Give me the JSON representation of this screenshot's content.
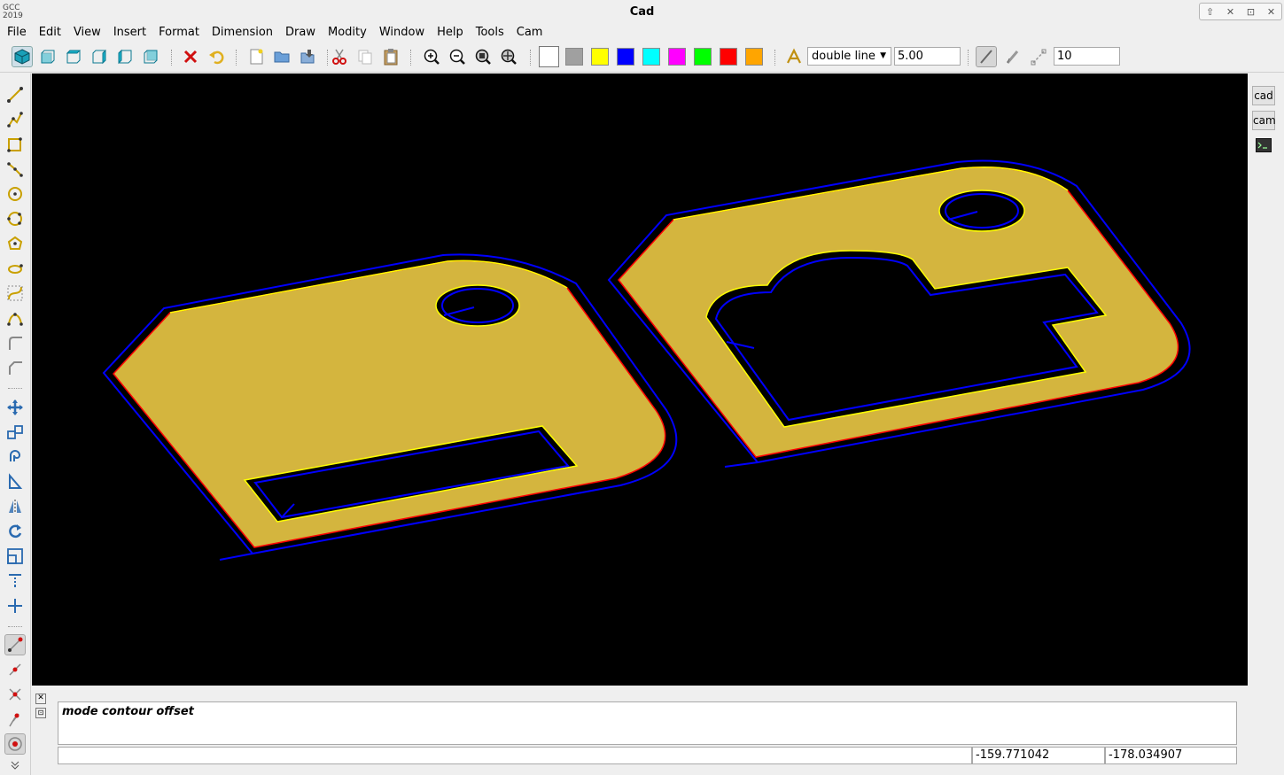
{
  "app": {
    "logo_line1": "GCC",
    "logo_line2": "2019",
    "title": "Cad"
  },
  "window_controls": [
    "up-arrow-icon",
    "close-icon",
    "maximize-icon",
    "close-icon"
  ],
  "menu": [
    "File",
    "Edit",
    "View",
    "Insert",
    "Format",
    "Dimension",
    "Draw",
    "Modity",
    "Window",
    "Help",
    "Tools",
    "Cam"
  ],
  "toolbar": {
    "view_icons": [
      "view-iso-icon",
      "view-front-icon",
      "view-top-icon",
      "view-right-icon",
      "view-left-icon",
      "view-back-icon"
    ],
    "colors": [
      "#ffffff",
      "#a0a0a0",
      "#ffff00",
      "#0000ff",
      "#00ffff",
      "#ff00ff",
      "#00ff00",
      "#ff0000",
      "#ffa500"
    ],
    "line_style": "double line",
    "line_width": "5.00",
    "snap_value": "10"
  },
  "left_tools": [
    "line-icon",
    "polyline-icon",
    "rectangle-icon",
    "polygon-icon",
    "circle-icon",
    "arc-icon",
    "ellipse-icon",
    "spline-icon",
    "bezier-icon",
    "curve-icon",
    "fillet-icon",
    "chamfer-icon",
    "move-icon",
    "copy-icon",
    "offset-icon",
    "mirror-icon",
    "mirror2-icon",
    "rotate-icon",
    "scale-icon",
    "dim-vertical-icon",
    "dim-horizontal-icon",
    "snap-end-icon",
    "snap-mid-icon",
    "snap-intersection-icon",
    "snap-center-icon",
    "snap-point-icon"
  ],
  "right_dock": {
    "cad_label": "cad",
    "cam_label": "cam"
  },
  "command": {
    "mode": "mode contour offset",
    "input": ""
  },
  "coords": {
    "x": "-159.771042",
    "y": "-178.034907"
  },
  "drawing_colors": {
    "fill": "#d4b53e",
    "offset_path": "#0000ff",
    "cut_edge": "#ff0000",
    "selected_edge": "#ffff00",
    "background": "#000000"
  }
}
